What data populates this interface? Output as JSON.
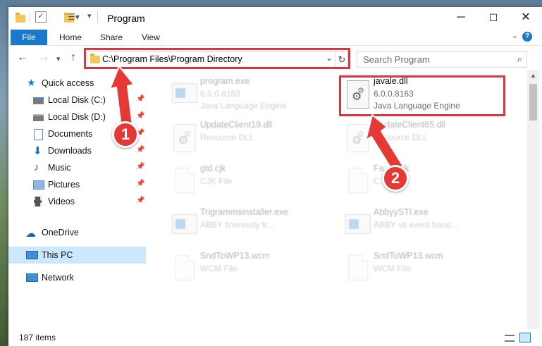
{
  "window": {
    "title": "Program",
    "minimize": "─",
    "maximize": "☐",
    "close": "✕"
  },
  "ribbon": {
    "tabs": [
      "File",
      "Home",
      "Share",
      "View"
    ],
    "help": "?"
  },
  "navigation": {
    "back": "←",
    "forward": "→",
    "recent": "▾",
    "up": "↑",
    "address": "C:\\Program Files\\Program Directory",
    "search_placeholder": "Search Program"
  },
  "sidebar": {
    "items": [
      {
        "label": "Quick access",
        "icon": "star-icon"
      },
      {
        "label": "Local Disk (C:)",
        "icon": "drive-icon",
        "pinned": true
      },
      {
        "label": "Local Disk (D:)",
        "icon": "drive-icon",
        "pinned": true
      },
      {
        "label": "Documents",
        "icon": "documents-icon",
        "pinned": true
      },
      {
        "label": "Downloads",
        "icon": "downloads-icon",
        "pinned": true
      },
      {
        "label": "Music",
        "icon": "music-icon",
        "pinned": true
      },
      {
        "label": "Pictures",
        "icon": "pictures-icon",
        "pinned": true
      },
      {
        "label": "Videos",
        "icon": "videos-icon",
        "pinned": true
      },
      {
        "label": "OneDrive",
        "icon": "cloud-icon"
      },
      {
        "label": "This PC",
        "icon": "computer-icon",
        "selected": true
      },
      {
        "label": "Network",
        "icon": "network-icon"
      }
    ]
  },
  "files": [
    {
      "name": "program.exe",
      "version": "6.0.0.8163",
      "desc": "Java Language Engine",
      "faded": true
    },
    {
      "name": "javale.dll",
      "version": "6.0.0.8163",
      "desc": "Java Language Engine",
      "faded": false
    },
    {
      "name": "UpdateClient19.dll",
      "desc": "Resource DLL",
      "faded": true
    },
    {
      "name": "UpdateClient65.dll",
      "desc": "Resource DLL",
      "faded": true
    },
    {
      "name": "gtd.cjk",
      "desc": "CJK File",
      "faded": true
    },
    {
      "name": "Fa...n.cjk",
      "desc": "C...",
      "faded": true
    },
    {
      "name": "Trigrammsinstaller.exe",
      "desc": "ABBY fineready tr...",
      "faded": true
    },
    {
      "name": "AbbyySTI.exe",
      "desc": "ABBY sti event hand...",
      "faded": true
    },
    {
      "name": "SndToWP13.wcm",
      "desc": "WCM File",
      "faded": true
    },
    {
      "name": "SndToWP13.wcm",
      "desc": "WCM File",
      "faded": true
    }
  ],
  "status": {
    "items_count": "187 items"
  },
  "callouts": [
    "1",
    "2"
  ],
  "colors": {
    "accent": "#1979ca",
    "highlight": "#d9363e",
    "selected": "#cce8ff"
  }
}
